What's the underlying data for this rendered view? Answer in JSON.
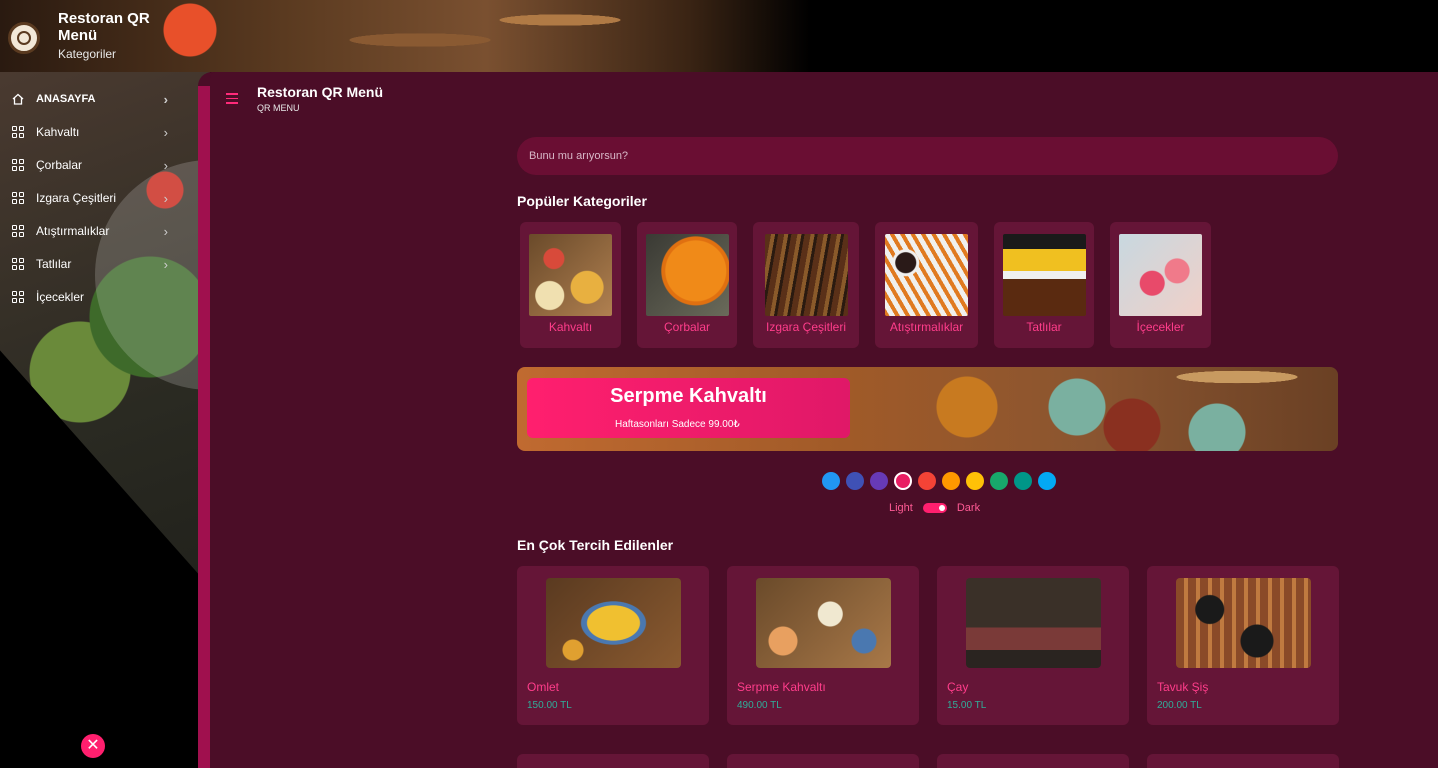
{
  "brand": {
    "title": "Restoran QR Menü",
    "subtitle": "Kategoriler"
  },
  "sidebar": {
    "items": [
      {
        "label": "ANASAYFA",
        "icon": "home-icon"
      },
      {
        "label": "Kahvaltı",
        "icon": "grid-icon"
      },
      {
        "label": "Çorbalar",
        "icon": "grid-icon"
      },
      {
        "label": "Izgara Çeşitleri",
        "icon": "grid-icon"
      },
      {
        "label": "Atıştırmalıklar",
        "icon": "grid-icon"
      },
      {
        "label": "Tatlılar",
        "icon": "grid-icon"
      },
      {
        "label": "İçecekler",
        "icon": "grid-icon"
      }
    ],
    "close_icon": "close-icon"
  },
  "header": {
    "title": "Restoran QR Menü",
    "subtitle": "QR MENU"
  },
  "search": {
    "placeholder": "Bunu mu arıyorsun?"
  },
  "popular": {
    "title": "Popüler Kategoriler",
    "items": [
      {
        "label": "Kahvaltı"
      },
      {
        "label": "Çorbalar"
      },
      {
        "label": "Izgara Çeşitleri"
      },
      {
        "label": "Atıştırmalıklar"
      },
      {
        "label": "Tatlılar"
      },
      {
        "label": "İçecekler"
      }
    ]
  },
  "banner": {
    "title": "Serpme Kahvaltı",
    "subtitle": "Haftasonları Sadece 99.00₺"
  },
  "theme": {
    "colors": [
      "#2196f3",
      "#3f51b5",
      "#673ab7",
      "#e91e63",
      "#f44336",
      "#ff9800",
      "#ffc107",
      "#18a86b",
      "#009688",
      "#03a9f4"
    ],
    "active_color": "#e91e63",
    "light_label": "Light",
    "dark_label": "Dark",
    "mode": "dark"
  },
  "most_preferred": {
    "title": "En Çok Tercih Edilenler",
    "items": [
      {
        "name": "Omlet",
        "price": "150.00 TL"
      },
      {
        "name": "Serpme Kahvaltı",
        "price": "490.00 TL"
      },
      {
        "name": "Çay",
        "price": "15.00 TL"
      },
      {
        "name": "Tavuk Şiş",
        "price": "200.00 TL"
      }
    ]
  },
  "colors": {
    "accent": "#ff1f6e",
    "panel": "#4b0d27",
    "card": "#651537",
    "price": "#2fae9a"
  }
}
